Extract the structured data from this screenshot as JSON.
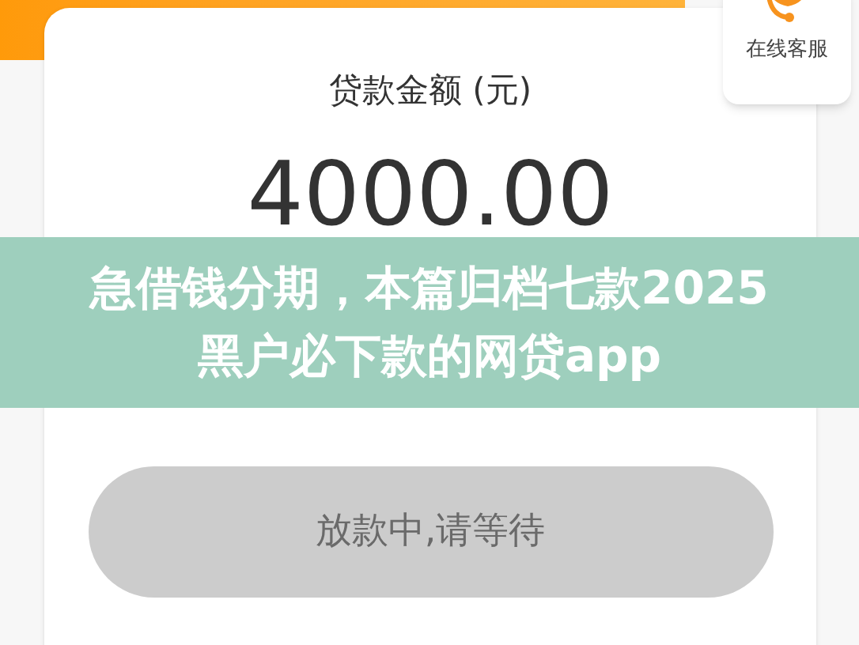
{
  "service": {
    "label": "在线客服"
  },
  "loan": {
    "label": "贷款金额 (元)",
    "amount": "4000.00"
  },
  "status_button": {
    "label": "放款中,请等待",
    "disabled": true
  },
  "banner": {
    "title": "急借钱分期，本篇归档七款2025黑户必下款的网贷app"
  }
}
